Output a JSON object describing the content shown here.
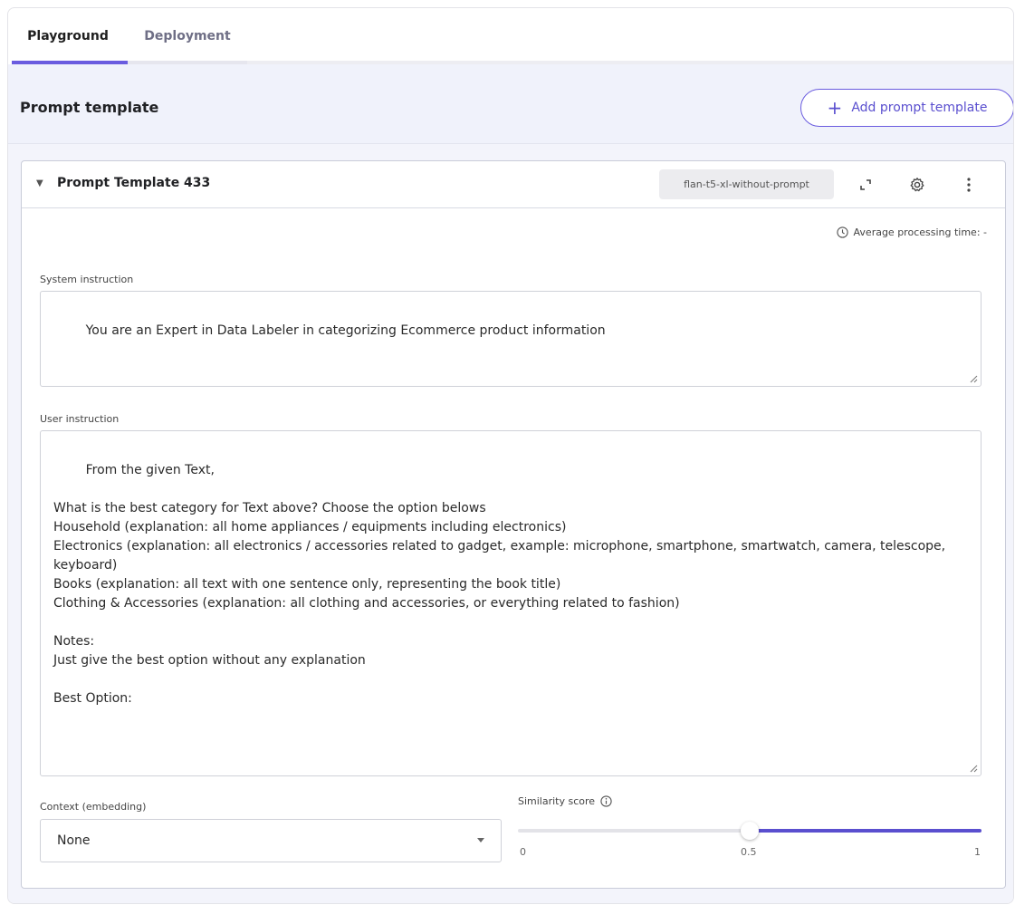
{
  "tabs": [
    {
      "label": "Playground",
      "active": true
    },
    {
      "label": "Deployment",
      "active": false
    }
  ],
  "section": {
    "title": "Prompt template",
    "add_button_label": "Add prompt template"
  },
  "template": {
    "title": "Prompt Template 433",
    "model": "flan-t5-xl-without-prompt",
    "processing_time_label": "Average processing time: -",
    "system_instruction_label": "System instruction",
    "system_instruction_value": "You are an Expert in Data Labeler in categorizing Ecommerce product information",
    "user_instruction_label": "User instruction",
    "user_instruction_value": "From the given Text,\n\nWhat is the best category for Text above? Choose the option belows\nHousehold (explanation: all home appliances / equipments including electronics)\nElectronics (explanation: all electronics / accessories related to gadget, example: microphone, smartphone, smartwatch, camera, telescope, keyboard)\nBooks (explanation: all text with one sentence only, representing the book title)\nClothing & Accessories (explanation: all clothing and accessories, or everything related to fashion)\n\nNotes:\nJust give the best option without any explanation\n\nBest Option:",
    "context_label": "Context (embedding)",
    "context_value": "None",
    "similarity_label": "Similarity score",
    "similarity": {
      "min": 0,
      "max": 1,
      "value": 0.5,
      "ticks": [
        "0",
        "0.5",
        "1"
      ]
    }
  },
  "colors": {
    "accent": "#5a4fcf",
    "header_bg": "#f0f2fb"
  },
  "icons": [
    "plus-icon",
    "caret-down-icon",
    "expand-icon",
    "gear-icon",
    "kebab-menu-icon",
    "clock-icon",
    "info-icon",
    "chevron-down-icon",
    "resize-handle-icon"
  ]
}
